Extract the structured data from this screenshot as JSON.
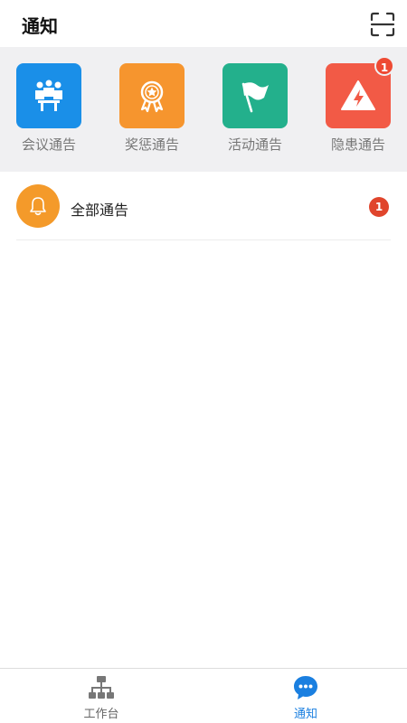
{
  "header": {
    "title": "通知",
    "scan_icon": "scan-icon"
  },
  "categories": [
    {
      "label": "会议通告",
      "icon": "meeting-icon",
      "color": "#1a8fe8",
      "badge": ""
    },
    {
      "label": "奖惩通告",
      "icon": "award-icon",
      "color": "#f6952e",
      "badge": ""
    },
    {
      "label": "活动通告",
      "icon": "flag-icon",
      "color": "#23b08c",
      "badge": ""
    },
    {
      "label": "隐患通告",
      "icon": "hazard-warning-icon",
      "color": "#f25a46",
      "badge": "1"
    }
  ],
  "notice_list": [
    {
      "label": "全部通告",
      "icon": "bell-icon",
      "color": "#f49a2a",
      "badge": "1"
    }
  ],
  "bottom_nav": {
    "active_color": "#1a7fe0",
    "inactive_color": "#666666",
    "items": [
      {
        "label": "工作台",
        "icon": "org-chart-icon",
        "active": false
      },
      {
        "label": "通知",
        "icon": "chat-bubble-icon",
        "active": true
      }
    ]
  }
}
